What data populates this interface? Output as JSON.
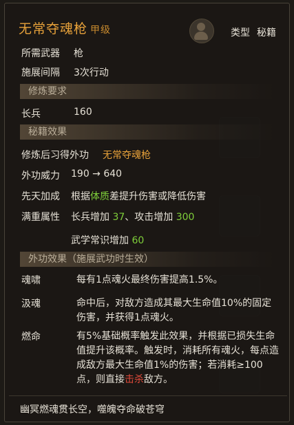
{
  "skill": {
    "name": "无常夺魂枪",
    "grade": "甲级",
    "type_label": "类型",
    "type_value": "秘籍"
  },
  "info": {
    "weapon_label": "所需武器",
    "weapon_value": "枪",
    "interval_label": "施展间隔",
    "interval_value": "3次行动"
  },
  "training": {
    "header": "修炼要求",
    "req_label": "长兵",
    "req_value": "160"
  },
  "manual": {
    "header": "秘籍效果",
    "learn_label": "修炼后习得外功",
    "learn_value": "无常夺魂枪",
    "power_label": "外功威力",
    "power_value": "190 → 640",
    "innate_label": "先天加成",
    "innate_pre": "根据",
    "innate_attr": "体质",
    "innate_post": "差提升伤害或降低伤害",
    "max_label": "满重属性",
    "max_line1_a": "长兵增加",
    "max_line1_a_val": "37",
    "max_line1_sep": "、攻击增加",
    "max_line1_b_val": "300",
    "max_line2_a": "武学常识增加",
    "max_line2_a_val": "60"
  },
  "effects": {
    "header": "外功效果（施展武功时生效）",
    "items": [
      {
        "name": "魂啸",
        "text": "每有1点魂火最终伤害提高1.5%。"
      },
      {
        "name": "汲魂",
        "text": "命中后，对敌方造成其最大生命值10%的固定伤害，并获得1点魂火。"
      },
      {
        "name": "燃命",
        "text_pre": "有5%基础概率触发此效果，并根据已损失生命值提升该概率。触发时，消耗所有魂火，每点造成敌方最大生命值1%的伤害；若消耗≥100点，则直接",
        "text_kill": "击杀",
        "text_post": "敌方。"
      }
    ]
  },
  "motto": "幽冥燃魂贯长空，噬魄夺命破苍穹",
  "colors": {
    "accent": "#e8a23a",
    "bonus": "#7fcf3a",
    "kill": "#e04a3a"
  }
}
